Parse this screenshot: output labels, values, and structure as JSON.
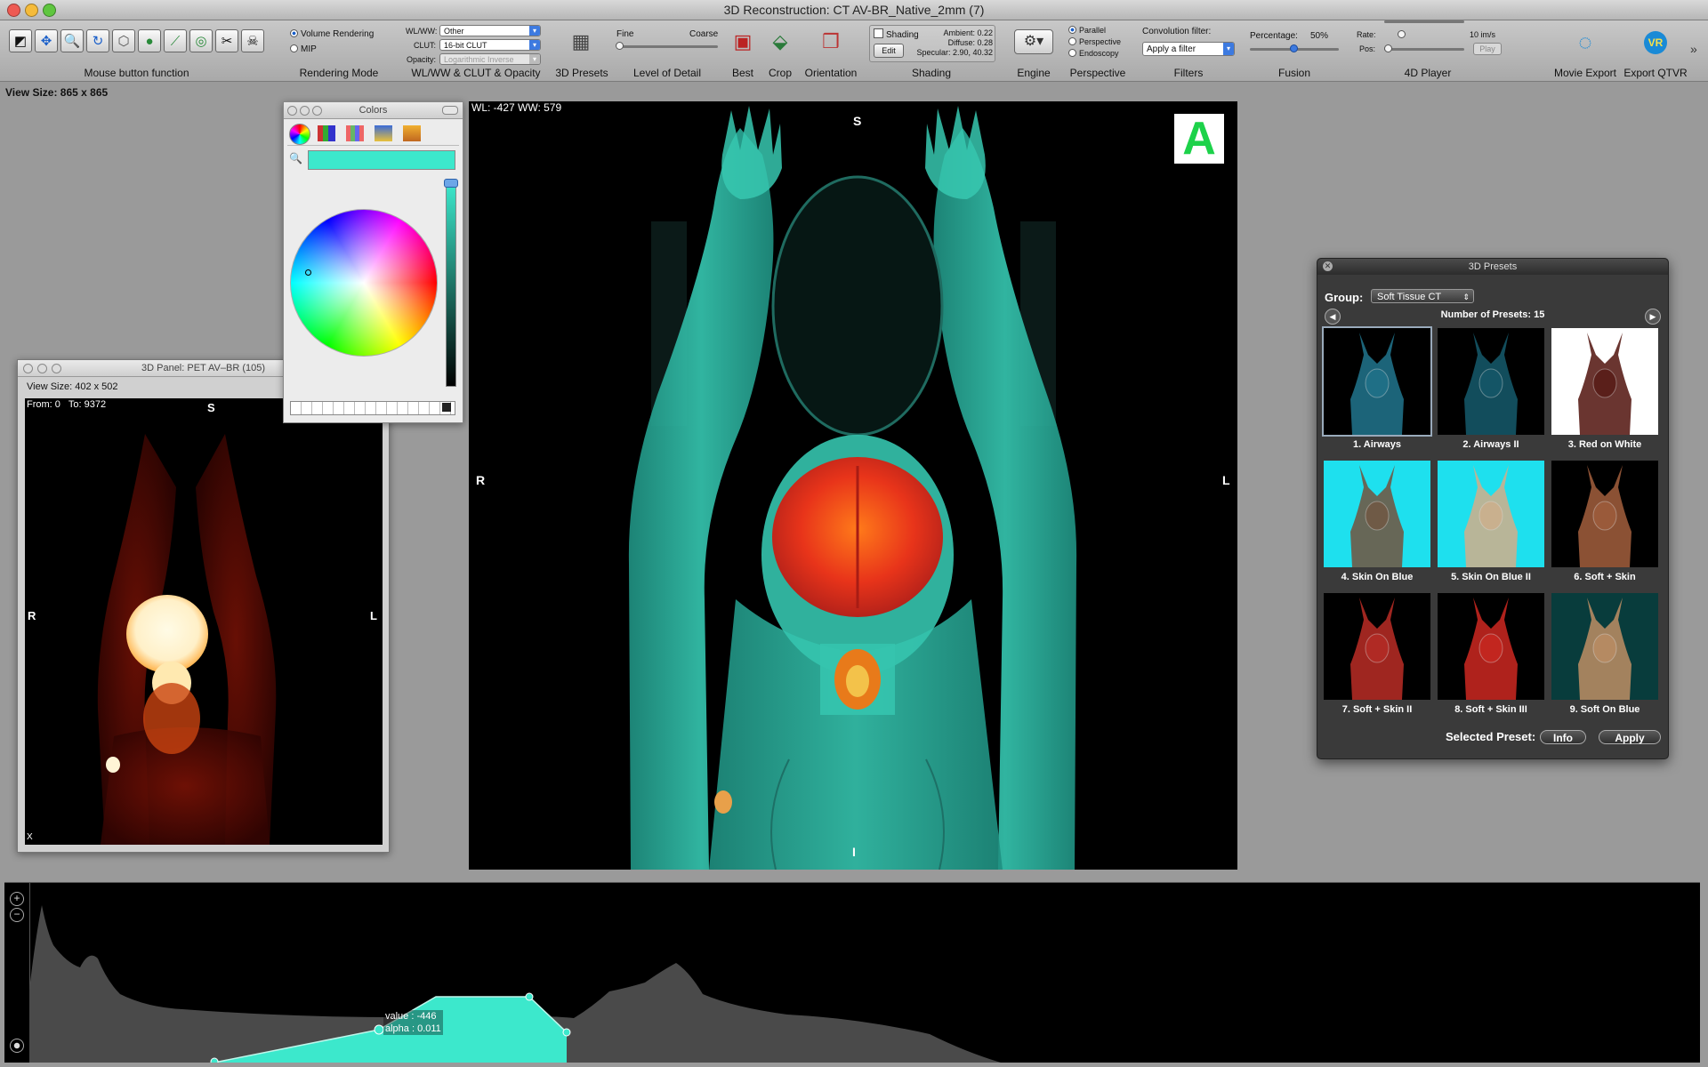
{
  "window": {
    "title": "3D Reconstruction: CT AV-BR_Native_2mm (7)"
  },
  "toolbar": {
    "groups": {
      "mouse": "Mouse button function",
      "rendering": "Rendering Mode",
      "wlww": "WL/WW & CLUT & Opacity",
      "presets": "3D Presets",
      "lod": "Level of Detail",
      "best": "Best",
      "crop": "Crop",
      "orientation": "Orientation",
      "shading": "Shading",
      "engine": "Engine",
      "perspective": "Perspective",
      "filters": "Filters",
      "fusion": "Fusion",
      "player": "4D Player",
      "movie": "Movie Export",
      "qtvr": "Export QTVR"
    },
    "rendering_modes": [
      "Volume Rendering",
      "MIP"
    ],
    "wlww_label": "WL/WW:",
    "wlww_value": "Other",
    "clut_label": "CLUT:",
    "clut_value": "16-bit CLUT",
    "opacity_label": "Opacity:",
    "opacity_value": "Logarithmic Inverse",
    "lod_fine": "Fine",
    "lod_coarse": "Coarse",
    "shading_checkbox": "Shading",
    "shading_edit": "Edit",
    "ambient": "Ambient: 0.22",
    "diffuse": "Diffuse: 0.28",
    "specular": "Specular: 2.90, 40.32",
    "perspective_options": [
      "Parallel",
      "Perspective",
      "Endoscopy"
    ],
    "convolution_label": "Convolution filter:",
    "convolution_value": "Apply a filter",
    "fusion_label": "Percentage:",
    "fusion_value": "50%",
    "rate_label": "Rate:",
    "rate_value": "10 im/s",
    "pos_label": "Pos:",
    "play": "Play",
    "qtvr_badge": "VR",
    "accent": "#3d7ae0"
  },
  "main": {
    "view_size": "View Size: 865 x 865",
    "wlww": "WL: -427 WW: 579",
    "orient_top": "S",
    "orient_left": "R",
    "orient_right": "L",
    "orient_bottom": "I",
    "badge": "A",
    "tissue_color": "#2fb9a4"
  },
  "colors_panel": {
    "title": "Colors",
    "current_color": "#3ce8cc"
  },
  "pet_panel": {
    "title": "3D Panel: PET AV–BR (105)",
    "view_size": "View Size: 402 x 502",
    "range": "From: 0   To: 9372",
    "orient_top": "S",
    "orient_left": "R",
    "orient_right": "L",
    "corner": "X"
  },
  "presets_panel": {
    "title": "3D Presets",
    "group_label": "Group:",
    "group_value": "Soft Tissue CT",
    "count": "Number of Presets: 15",
    "presets": [
      {
        "label": "1. Airways",
        "bg": "#000000",
        "fg": "#1f6f86"
      },
      {
        "label": "2. Airways II",
        "bg": "#000000",
        "fg": "#145566"
      },
      {
        "label": "3. Red on White",
        "bg": "#ffffff",
        "fg": "#5a1f1a"
      },
      {
        "label": "4. Skin On Blue",
        "bg": "#1ee0ee",
        "fg": "#6f5a46"
      },
      {
        "label": "5. Skin On Blue II",
        "bg": "#1ee0ee",
        "fg": "#c9b08e"
      },
      {
        "label": "6. Soft + Skin",
        "bg": "#000000",
        "fg": "#9a5a3a"
      },
      {
        "label": "7. Soft + Skin II",
        "bg": "#000000",
        "fg": "#b02a24"
      },
      {
        "label": "8. Soft + Skin III",
        "bg": "#000000",
        "fg": "#c2261f"
      },
      {
        "label": "9. Soft On Blue",
        "bg": "#083c3c",
        "fg": "#b58a62"
      }
    ],
    "selected_label": "Selected Preset:",
    "info": "Info",
    "apply": "Apply"
  },
  "histogram": {
    "tooltip_value": "value : -446",
    "tooltip_alpha": "alpha : 0.011",
    "fill_color": "#3ce8cc"
  }
}
